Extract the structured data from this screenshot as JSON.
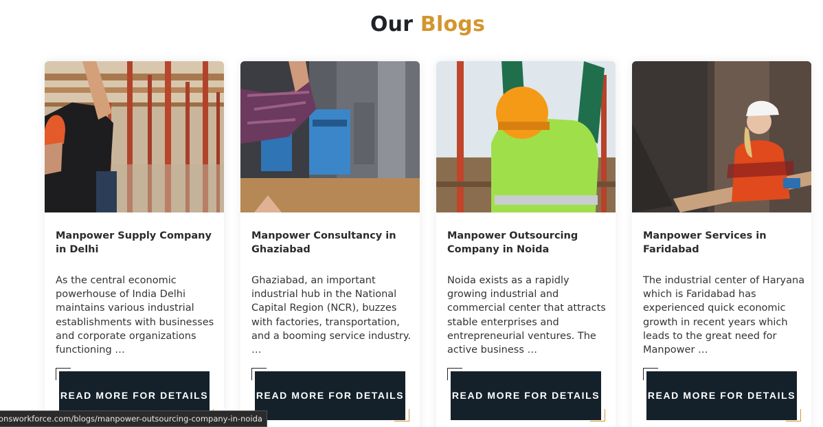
{
  "section": {
    "title_main": "Our",
    "title_accent": "Blogs"
  },
  "colors": {
    "accent": "#d4952e",
    "button_bg": "#15212a",
    "title_dark": "#1f2328"
  },
  "cards": [
    {
      "title": "Manpower Supply Company in Delhi",
      "excerpt": "As the central economic powerhouse of India Delhi maintains various industrial establishments with businesses and corporate organizations functioning …",
      "button": "READ MORE FOR DETAILS",
      "image_icon": "construction-worker-photo"
    },
    {
      "title": "Manpower Consultancy in Ghaziabad",
      "excerpt": "Ghaziabad, an important industrial hub in the National Capital Region (NCR), buzzes with factories, transportation, and a booming service industry. …",
      "button": "READ MORE FOR DETAILS",
      "image_icon": "machinery-worker-photo"
    },
    {
      "title": "Manpower Outsourcing Company in Noida",
      "excerpt": "Noida exists as a rapidly growing industrial and commercial center that attracts stable enterprises and entrepreneurial ventures. The active business …",
      "button": "READ MORE FOR DETAILS",
      "image_icon": "safety-vest-worker-photo"
    },
    {
      "title": "Manpower Services in Faridabad",
      "excerpt": "The industrial center of Haryana which is Faridabad has experienced quick economic growth in recent years which leads to the great need for Manpower …",
      "button": "READ MORE FOR DETAILS",
      "image_icon": "female-worker-photo"
    }
  ],
  "status_bar": {
    "url": "onsworkforce.com/blogs/manpower-outsourcing-company-in-noida"
  }
}
